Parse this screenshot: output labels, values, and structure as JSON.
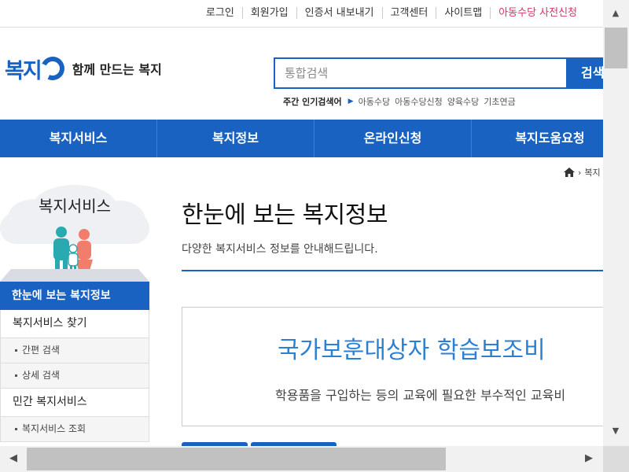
{
  "utility_nav": [
    "로그인",
    "회원가입",
    "인증서 내보내기",
    "고객센터",
    "사이트맵",
    "아동수당 사전신청"
  ],
  "logo": {
    "mark": "복지",
    "mark_tail": "r",
    "slogan": "함께 만드는 복지"
  },
  "search": {
    "placeholder": "통합검색",
    "button": "검색"
  },
  "popular": {
    "title": "주간 인기검색어",
    "keywords": [
      "아동수당",
      "아동수당신청",
      "양육수당",
      "기초연금"
    ]
  },
  "gnb": [
    "복지서비스",
    "복지정보",
    "온라인신청",
    "복지도움요청"
  ],
  "breadcrumb": {
    "current": "복지"
  },
  "side": {
    "title": "복지서비스",
    "menu": [
      {
        "label": "한눈에 보는 복지정보",
        "type": "active"
      },
      {
        "label": "복지서비스 찾기",
        "type": "item"
      },
      {
        "label": "간편 검색",
        "type": "sub"
      },
      {
        "label": "상세 검색",
        "type": "sub"
      },
      {
        "label": "민간 복지서비스",
        "type": "item"
      },
      {
        "label": "복지서비스 조회",
        "type": "sub"
      }
    ]
  },
  "content": {
    "title": "한눈에 보는 복지정보",
    "desc": "다양한 복지서비스 정보를 안내해드립니다.",
    "card_title": "국가보훈대상자 학습보조비",
    "card_desc": "학용품을 구입하는 등의 교육에 필요한 부수적인 교육비"
  },
  "colors": {
    "brand": "#1a62c2",
    "accent": "#d6336c",
    "card_title": "#2c80d3"
  }
}
